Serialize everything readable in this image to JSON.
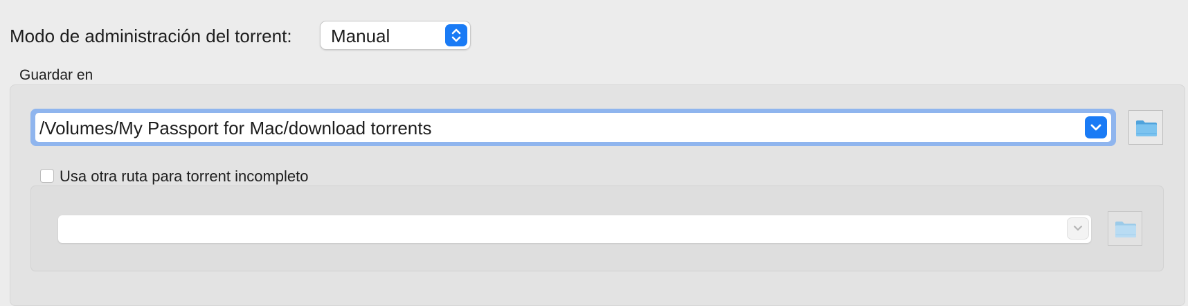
{
  "torrent_mode": {
    "label": "Modo de administración del torrent:",
    "value": "Manual",
    "stepper_icon": "up-down-chevrons-icon"
  },
  "save_group": {
    "title": "Guardar en",
    "save_path": {
      "value": "/Volumes/My Passport for Mac/download torrents",
      "dropdown_icon": "chevron-down-icon",
      "browse_icon": "folder-icon"
    },
    "incomplete": {
      "checkbox_label": "Usa otra ruta para torrent incompleto",
      "checked": false,
      "path_value": "",
      "dropdown_icon": "chevron-down-icon",
      "browse_icon": "folder-icon"
    }
  },
  "colors": {
    "accent": "#1a7bf5",
    "focus_ring": "#8fb5ee",
    "window_bg": "#ececec",
    "group_bg": "#e3e3e3"
  }
}
